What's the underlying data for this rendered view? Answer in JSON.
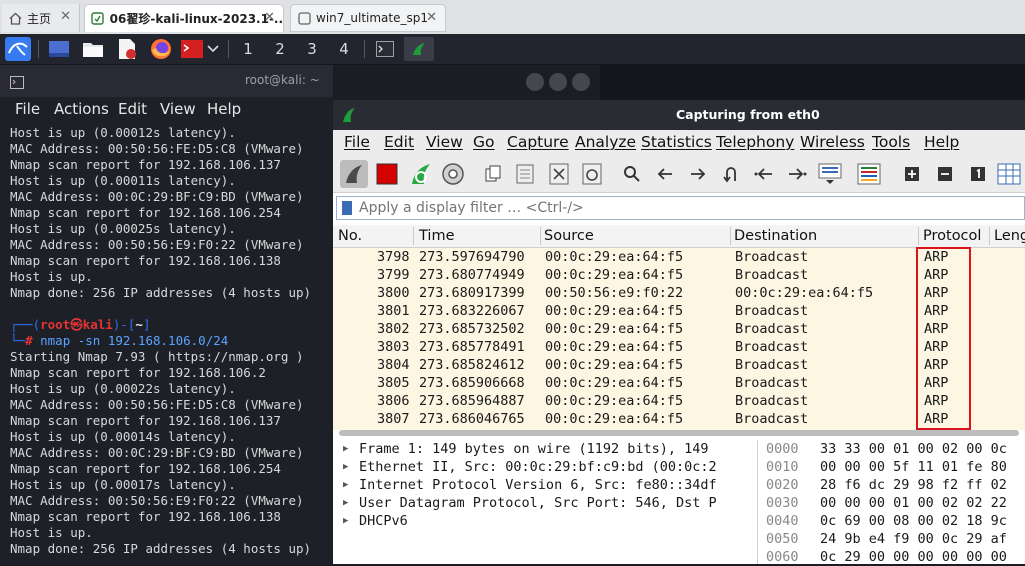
{
  "browser": {
    "tabs": [
      {
        "label": "主页",
        "icon": "home-icon"
      },
      {
        "label": "06翟珍-kali-linux-2023.1-...",
        "icon": "vm-icon"
      },
      {
        "label": "win7_ultimate_sp1",
        "icon": "vm-icon"
      }
    ],
    "close_glyph": "✕"
  },
  "panel": {
    "workspaces": [
      "1",
      "2",
      "3",
      "4"
    ]
  },
  "terminal": {
    "title": "root@kali: ~",
    "menu": [
      "File",
      "Actions",
      "Edit",
      "View",
      "Help"
    ],
    "prompt_user": "root㉿kali",
    "prompt_dir": "~",
    "command": "nmap -sn 192.168.106.0/24",
    "lines_before": [
      "Host is up (0.00012s latency).",
      "MAC Address: 00:50:56:FE:D5:C8 (VMware)",
      "Nmap scan report for 192.168.106.137",
      "Host is up (0.00011s latency).",
      "MAC Address: 00:0C:29:BF:C9:BD (VMware)",
      "Nmap scan report for 192.168.106.254",
      "Host is up (0.00025s latency).",
      "MAC Address: 00:50:56:E9:F0:22 (VMware)",
      "Nmap scan report for 192.168.106.138",
      "Host is up.",
      "Nmap done: 256 IP addresses (4 hosts up)"
    ],
    "lines_after": [
      "Starting Nmap 7.93 ( https://nmap.org )",
      "Nmap scan report for 192.168.106.2",
      "Host is up (0.00022s latency).",
      "MAC Address: 00:50:56:FE:D5:C8 (VMware)",
      "Nmap scan report for 192.168.106.137",
      "Host is up (0.00014s latency).",
      "MAC Address: 00:0C:29:BF:C9:BD (VMware)",
      "Nmap scan report for 192.168.106.254",
      "Host is up (0.00017s latency).",
      "MAC Address: 00:50:56:E9:F0:22 (VMware)",
      "Nmap scan report for 192.168.106.138",
      "Host is up.",
      "Nmap done: 256 IP addresses (4 hosts up)"
    ]
  },
  "wireshark": {
    "title": "Capturing from eth0",
    "menu": [
      "File",
      "Edit",
      "View",
      "Go",
      "Capture",
      "Analyze",
      "Statistics",
      "Telephony",
      "Wireless",
      "Tools",
      "Help"
    ],
    "filter_placeholder": "Apply a display filter … <Ctrl-/>",
    "columns": [
      "No.",
      "Time",
      "Source",
      "Destination",
      "Protocol",
      "Leng"
    ],
    "packets": [
      [
        "3798",
        "273.597694790",
        "00:0c:29:ea:64:f5",
        "Broadcast",
        "ARP"
      ],
      [
        "3799",
        "273.680774949",
        "00:0c:29:ea:64:f5",
        "Broadcast",
        "ARP"
      ],
      [
        "3800",
        "273.680917399",
        "00:50:56:e9:f0:22",
        "00:0c:29:ea:64:f5",
        "ARP"
      ],
      [
        "3801",
        "273.683226067",
        "00:0c:29:ea:64:f5",
        "Broadcast",
        "ARP"
      ],
      [
        "3802",
        "273.685732502",
        "00:0c:29:ea:64:f5",
        "Broadcast",
        "ARP"
      ],
      [
        "3803",
        "273.685778491",
        "00:0c:29:ea:64:f5",
        "Broadcast",
        "ARP"
      ],
      [
        "3804",
        "273.685824612",
        "00:0c:29:ea:64:f5",
        "Broadcast",
        "ARP"
      ],
      [
        "3805",
        "273.685906668",
        "00:0c:29:ea:64:f5",
        "Broadcast",
        "ARP"
      ],
      [
        "3806",
        "273.685964887",
        "00:0c:29:ea:64:f5",
        "Broadcast",
        "ARP"
      ],
      [
        "3807",
        "273.686046765",
        "00:0c:29:ea:64:f5",
        "Broadcast",
        "ARP"
      ]
    ],
    "details": [
      "Frame 1: 149 bytes on wire (1192 bits), 149",
      "Ethernet II, Src: 00:0c:29:bf:c9:bd (00:0c:2",
      "Internet Protocol Version 6, Src: fe80::34df",
      "User Datagram Protocol, Src Port: 546, Dst P",
      "DHCPv6"
    ],
    "bytes": [
      [
        "0000",
        "33 33 00 01 00 02 00 0c"
      ],
      [
        "0010",
        "00 00 00 5f 11 01 fe 80"
      ],
      [
        "0020",
        "28 f6 dc 29 98 f2 ff 02"
      ],
      [
        "0030",
        "00 00 00 01 00 02 02 22"
      ],
      [
        "0040",
        "0c 69 00 08 00 02 18 9c"
      ],
      [
        "0050",
        "24 9b e4 f9 00 0c 29 af"
      ],
      [
        "0060",
        "0c 29 00 00 00 00 00 00"
      ]
    ],
    "highlight_color": "#d9141b",
    "row_bg": "#fdf6e3"
  }
}
